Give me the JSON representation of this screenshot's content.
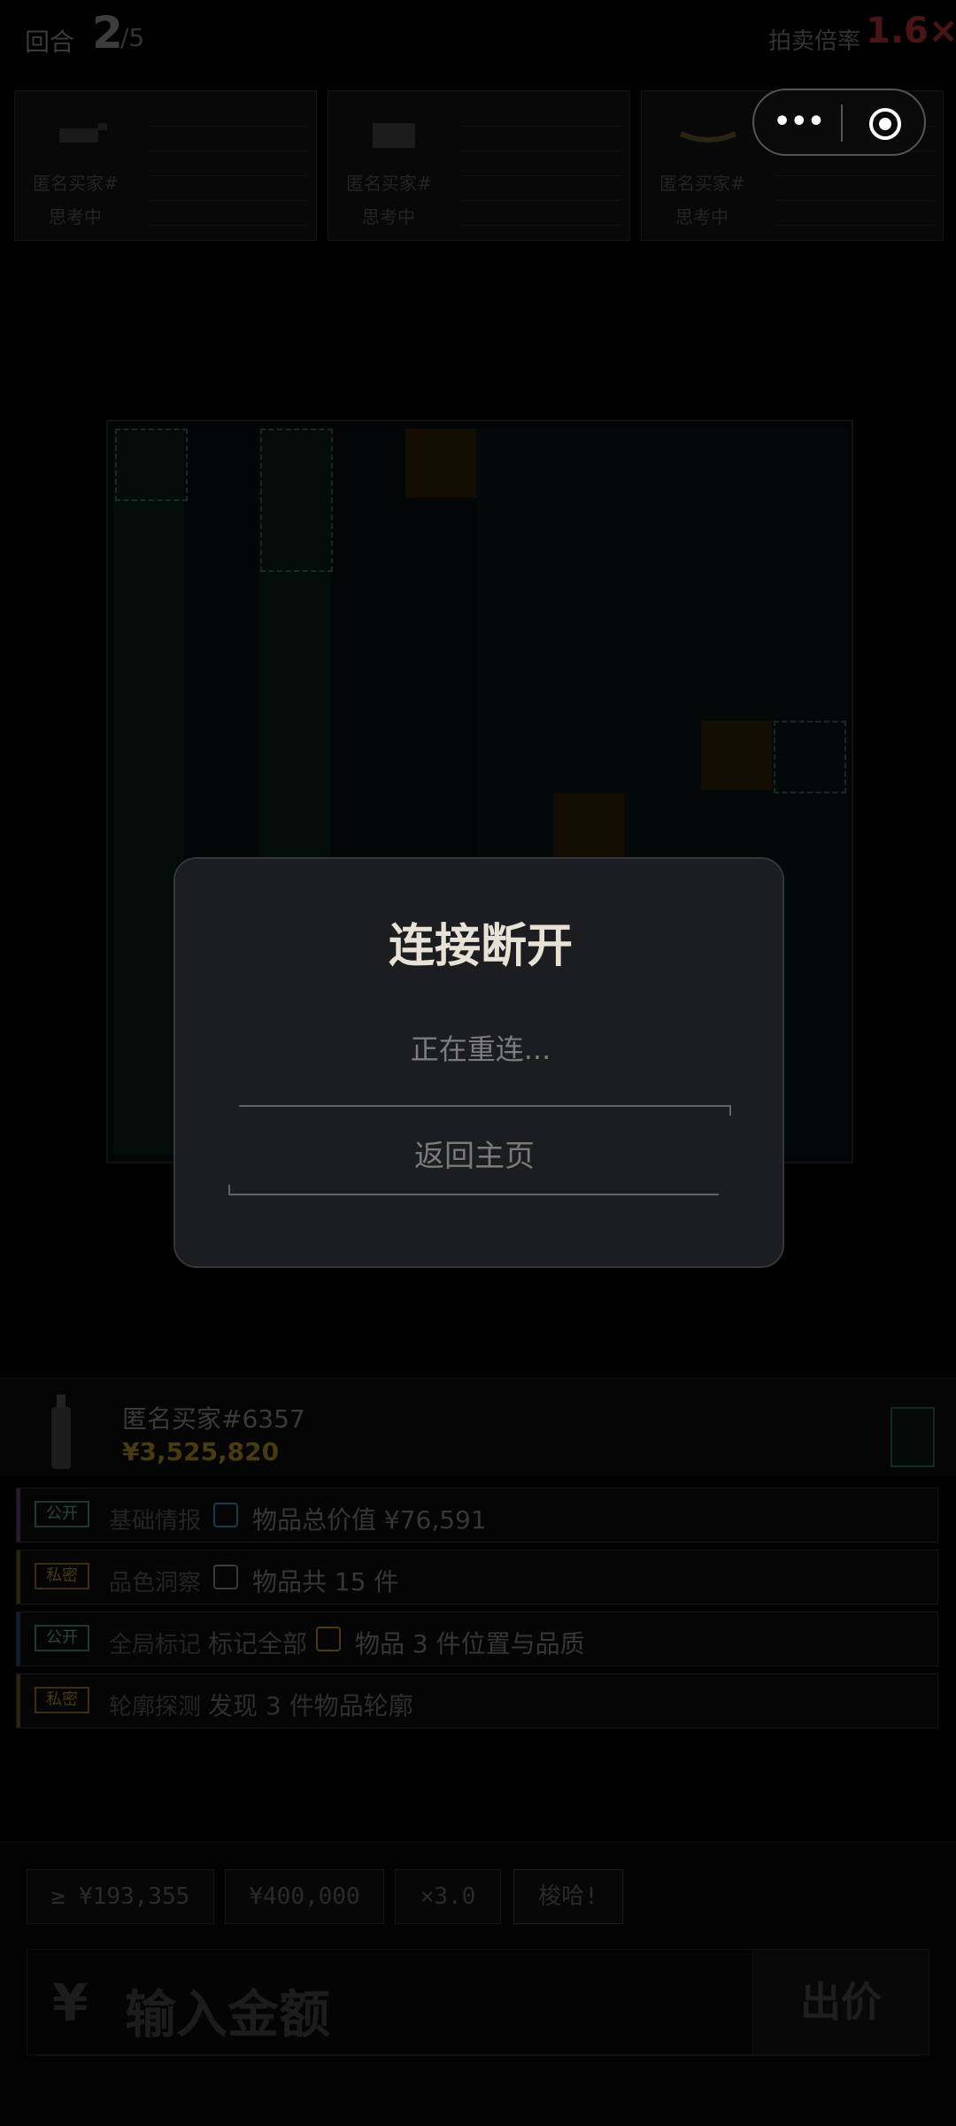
{
  "round": {
    "label": "回合",
    "current": "2",
    "total": "/5"
  },
  "multiplier": {
    "label": "拍卖倍率",
    "value": "1.6×"
  },
  "capsule": {
    "menu_icon": "more-dots-icon",
    "close_icon": "target-close-icon"
  },
  "players": [
    {
      "name": "匿名买家#",
      "status": "思考中"
    },
    {
      "name": "匿名买家#",
      "status": "思考中"
    },
    {
      "name": "匿名买家#",
      "status": "思考中"
    }
  ],
  "modal": {
    "title": "连接断开",
    "subtitle": "正在重连...",
    "button": "返回主页"
  },
  "buyer": {
    "name": "匿名买家#6357",
    "value": "¥3,525,820"
  },
  "info_rows": [
    {
      "tag": "公开",
      "label": "基础情报",
      "mark": "",
      "desc": "物品总价值 ¥76,591",
      "tag_color": "#2a4a3c",
      "box_color": "#1a3a4a"
    },
    {
      "tag": "私密",
      "label": "品色洞察",
      "mark": "",
      "desc": "物品共 15 件",
      "tag_color": "#4a3a14",
      "box_color": "#3a3a3a"
    },
    {
      "tag": "公开",
      "label": "全局标记",
      "mark": "标记全部",
      "desc": "物品 3 件位置与品质",
      "tag_color": "#2a4a3c",
      "box_color": "#4a3a14"
    },
    {
      "tag": "私密",
      "label": "轮廓探测",
      "mark": "发现 3 件物品轮廓",
      "desc": "",
      "tag_color": "#4a3a14",
      "box_color": ""
    }
  ],
  "quick_bids": [
    "≥ ¥193,355",
    "¥400,000",
    "×3.0",
    "梭哈!"
  ],
  "amount_input": {
    "currency": "¥",
    "placeholder": "输入金额"
  },
  "offer_button": "出价",
  "colors": {
    "accent_red": "#4a1414",
    "gold": "#4a3a10",
    "modal_bg": "#1c1d20"
  }
}
